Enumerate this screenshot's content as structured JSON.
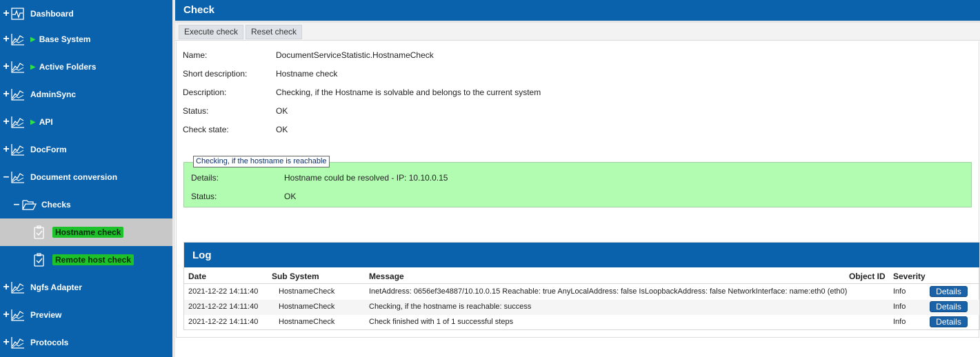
{
  "sidebar": {
    "items": [
      {
        "label": "Dashboard",
        "toggle": "+",
        "arrow": false
      },
      {
        "label": "Base System",
        "toggle": "+",
        "arrow": true
      },
      {
        "label": "Active Folders",
        "toggle": "+",
        "arrow": true
      },
      {
        "label": "AdminSync",
        "toggle": "+",
        "arrow": false
      },
      {
        "label": "API",
        "toggle": "+",
        "arrow": true
      },
      {
        "label": "DocForm",
        "toggle": "+",
        "arrow": false
      },
      {
        "label": "Document conversion",
        "toggle": "–",
        "arrow": false
      },
      {
        "label": "Checks",
        "toggle": "–",
        "arrow": false
      },
      {
        "label": "Hostname check",
        "selected": true
      },
      {
        "label": "Remote host check"
      },
      {
        "label": "Ngfs Adapter",
        "toggle": "+",
        "arrow": false
      },
      {
        "label": "Preview",
        "toggle": "+",
        "arrow": false
      },
      {
        "label": "Protocols",
        "toggle": "+",
        "arrow": false
      }
    ],
    "arrow_glyph": "▶"
  },
  "main": {
    "title": "Check",
    "toolbar": {
      "execute_label": "Execute check",
      "reset_label": "Reset check"
    },
    "fields": [
      {
        "label": "Name:",
        "value": "DocumentServiceStatistic.HostnameCheck"
      },
      {
        "label": "Short description:",
        "value": "Hostname check"
      },
      {
        "label": "Description:",
        "value": "Checking, if the Hostname is solvable and belongs to the current system"
      },
      {
        "label": "Status:",
        "value": "OK"
      },
      {
        "label": "Check state:",
        "value": "OK"
      }
    ],
    "step": {
      "legend": "Checking, if the hostname is reachable",
      "rows": [
        {
          "label": "Details:",
          "value": "Hostname could be resolved - IP: 10.10.0.15"
        },
        {
          "label": "Status:",
          "value": "OK"
        }
      ]
    },
    "log": {
      "title": "Log",
      "columns": [
        "Date",
        "Sub System",
        "Message",
        "Object ID",
        "Severity"
      ],
      "rows": [
        {
          "date": "2021-12-22 14:11:40",
          "subsystem": "HostnameCheck",
          "message": "InetAddress: 0656ef3e4887/10.10.0.15 Reachable: true AnyLocalAddress: false IsLoopbackAddress: false NetworkInterface: name:eth0 (eth0)",
          "object_id": "",
          "severity": "Info",
          "action": "Details"
        },
        {
          "date": "2021-12-22 14:11:40",
          "subsystem": "HostnameCheck",
          "message": "Checking, if the hostname is reachable: success",
          "object_id": "",
          "severity": "Info",
          "action": "Details"
        },
        {
          "date": "2021-12-22 14:11:40",
          "subsystem": "HostnameCheck",
          "message": "Check finished with 1 of 1 successful steps",
          "object_id": "",
          "severity": "Info",
          "action": "Details"
        }
      ]
    }
  },
  "colors": {
    "brand_blue": "#0a62ad",
    "success_green": "#1dc22b",
    "step_ok_bg": "#b1fcb1"
  }
}
